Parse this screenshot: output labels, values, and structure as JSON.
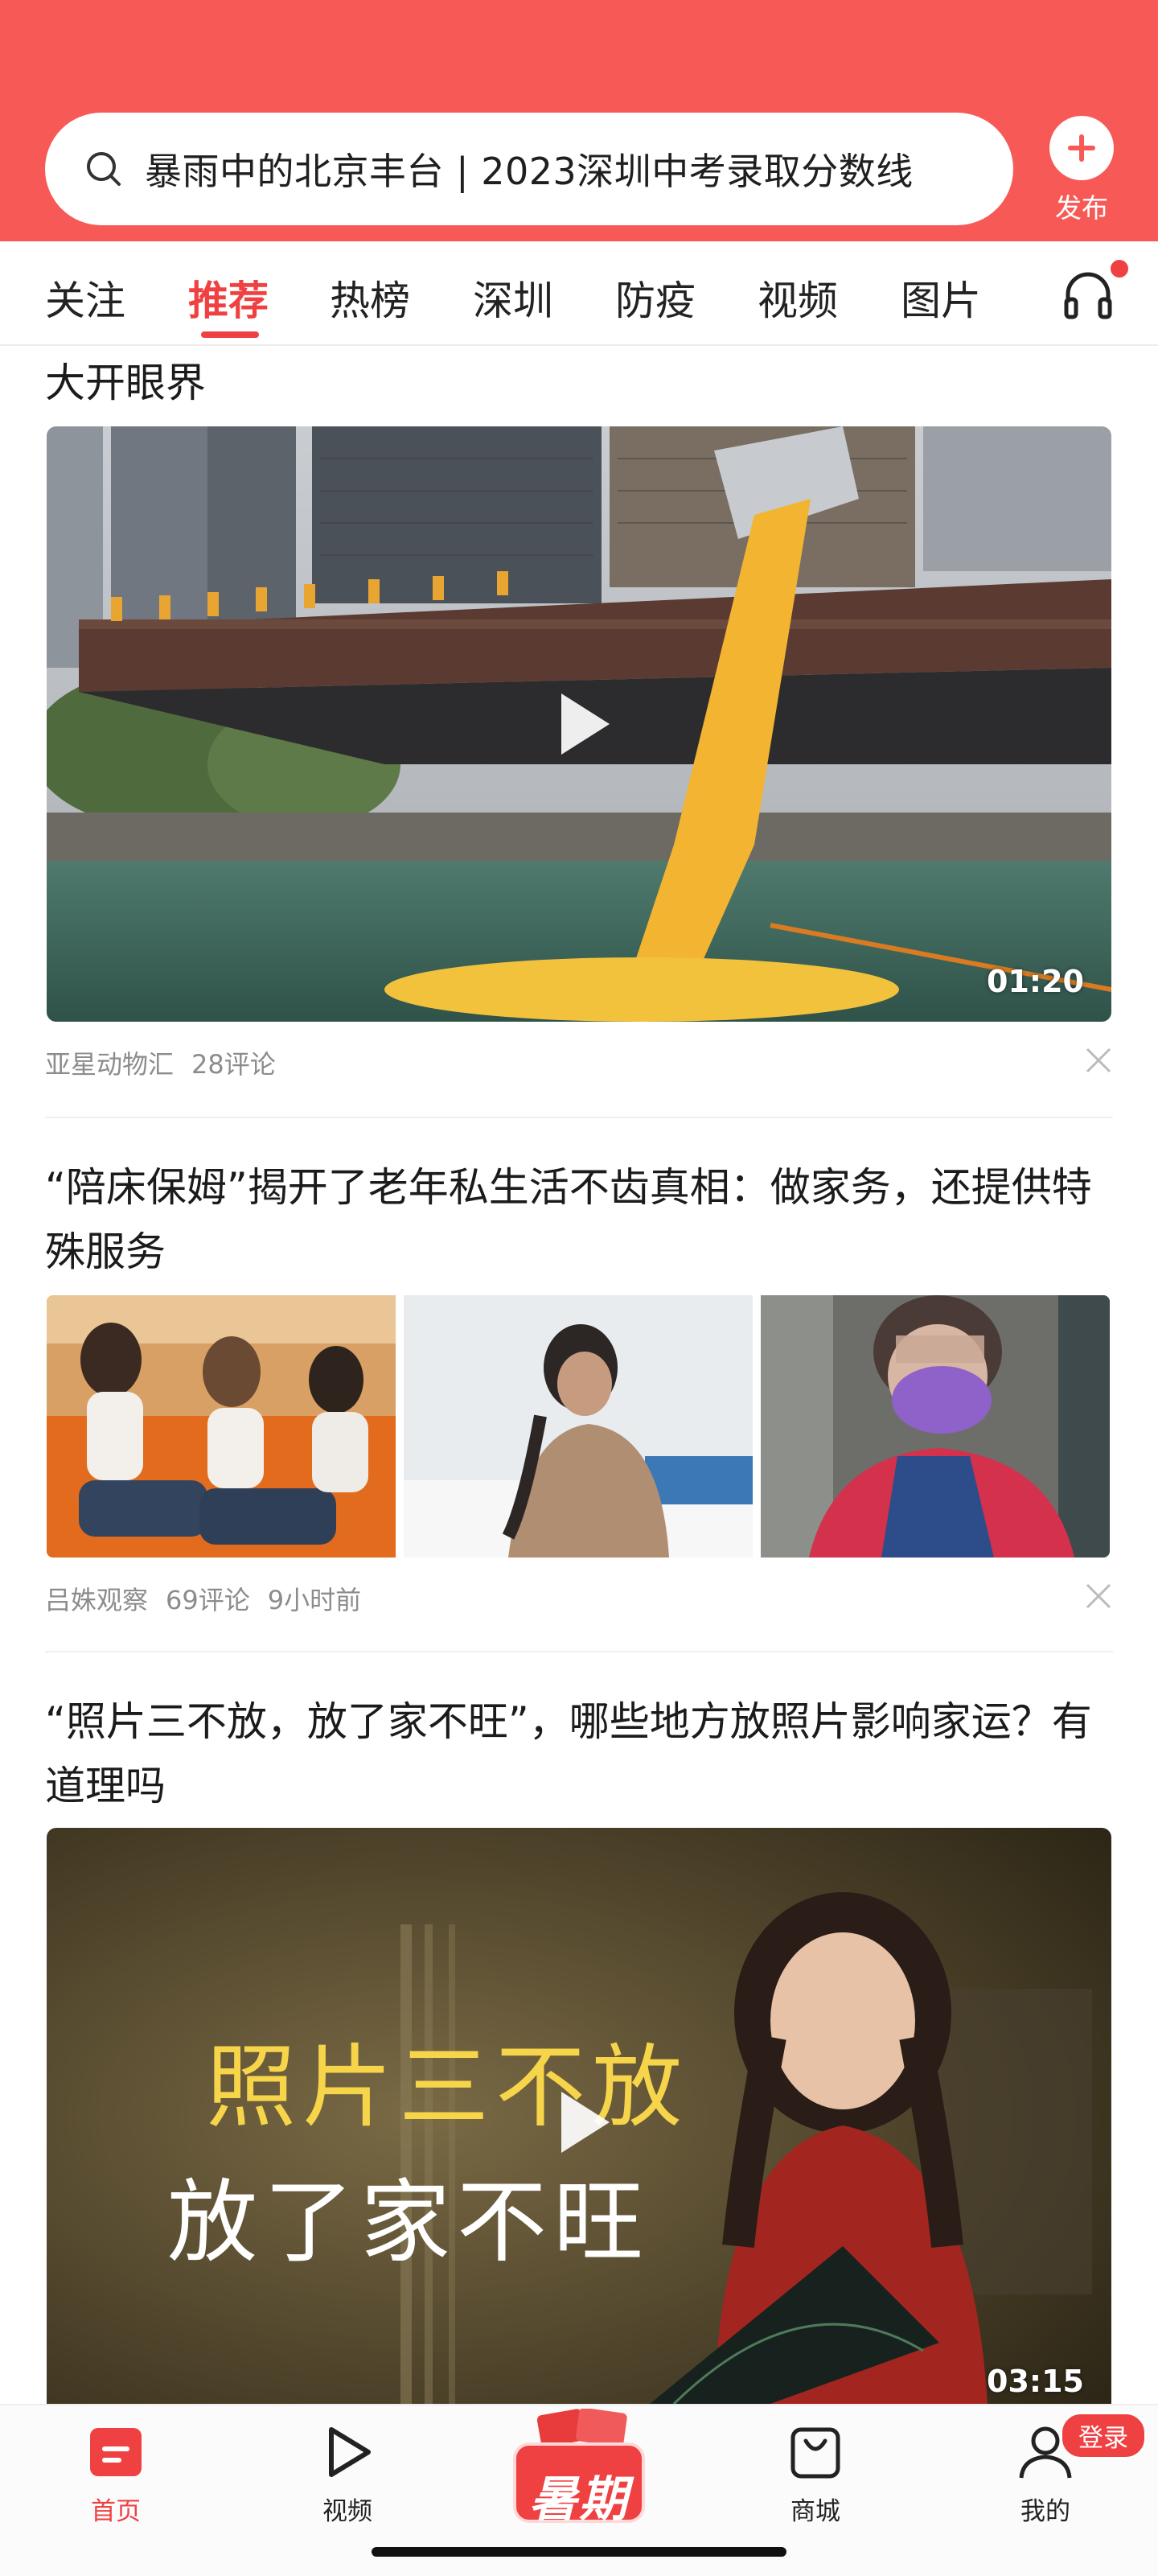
{
  "header": {
    "search_text": "暴雨中的北京丰台 | 2023深圳中考录取分数线",
    "publish_label": "发布",
    "bg_color": "#f75a56"
  },
  "tabs": [
    {
      "label": "关注",
      "active": false
    },
    {
      "label": "推荐",
      "active": true
    },
    {
      "label": "热榜",
      "active": false
    },
    {
      "label": "深圳",
      "active": false
    },
    {
      "label": "防疫",
      "active": false
    },
    {
      "label": "视频",
      "active": false
    },
    {
      "label": "图片",
      "active": false
    }
  ],
  "tabs_extra_icon": "headphone-icon",
  "accent_color": "#f04142",
  "feed": [
    {
      "title": "大开眼界",
      "type": "video",
      "duration": "01:20",
      "source": "亚星动物汇",
      "comments": "28评论"
    },
    {
      "title": "“陪床保姆”揭开了老年私生活不齿真相：做家务，还提供特殊服务",
      "type": "three-images",
      "source": "吕姝观察",
      "comments": "69评论",
      "time": "9小时前"
    },
    {
      "title": "“照片三不放，放了家不旺”，哪些地方放照片影响家运？有道理吗",
      "type": "video",
      "duration": "03:15",
      "overlay_line1": "照片三不放",
      "overlay_line2": "放了家不旺"
    }
  ],
  "bottom_nav": {
    "items": [
      {
        "label": "首页",
        "icon": "home-icon",
        "active": true
      },
      {
        "label": "视频",
        "icon": "play-icon",
        "active": false
      },
      {
        "label": "暑期",
        "icon": "summer-promo-icon",
        "active": false
      },
      {
        "label": "商城",
        "icon": "shopping-bag-icon",
        "active": false
      },
      {
        "label": "我的",
        "icon": "user-icon",
        "active": false
      }
    ],
    "login_badge": "登录"
  }
}
